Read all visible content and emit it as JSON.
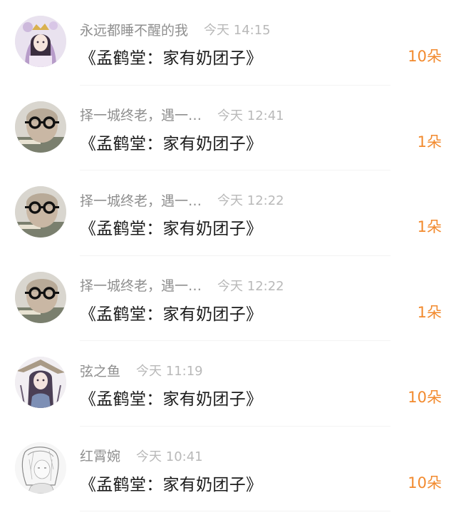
{
  "gifts": [
    {
      "user": "永远都睡不醒的我",
      "time": "今天 14:15",
      "book": "《孟鹤堂：家有奶团子》",
      "count": "10朵",
      "avatar": "anime-girl-lavender"
    },
    {
      "user": "择一城终老，遇一…",
      "time": "今天 12:41",
      "book": "《孟鹤堂：家有奶团子》",
      "count": "1朵",
      "avatar": "person-glasses"
    },
    {
      "user": "择一城终老，遇一…",
      "time": "今天 12:22",
      "book": "《孟鹤堂：家有奶团子》",
      "count": "1朵",
      "avatar": "person-glasses"
    },
    {
      "user": "择一城终老，遇一…",
      "time": "今天 12:22",
      "book": "《孟鹤堂：家有奶团子》",
      "count": "1朵",
      "avatar": "person-glasses"
    },
    {
      "user": "弦之鱼",
      "time": "今天 11:19",
      "book": "《孟鹤堂：家有奶团子》",
      "count": "10朵",
      "avatar": "anime-girl-hat"
    },
    {
      "user": "红霄婉",
      "time": "今天 10:41",
      "book": "《孟鹤堂：家有奶团子》",
      "count": "10朵",
      "avatar": "sketch-girl"
    }
  ],
  "colors": {
    "count": "#f28a2e",
    "name": "#8f8f8f",
    "time": "#b9b9b9",
    "title": "#1b1b1b"
  }
}
